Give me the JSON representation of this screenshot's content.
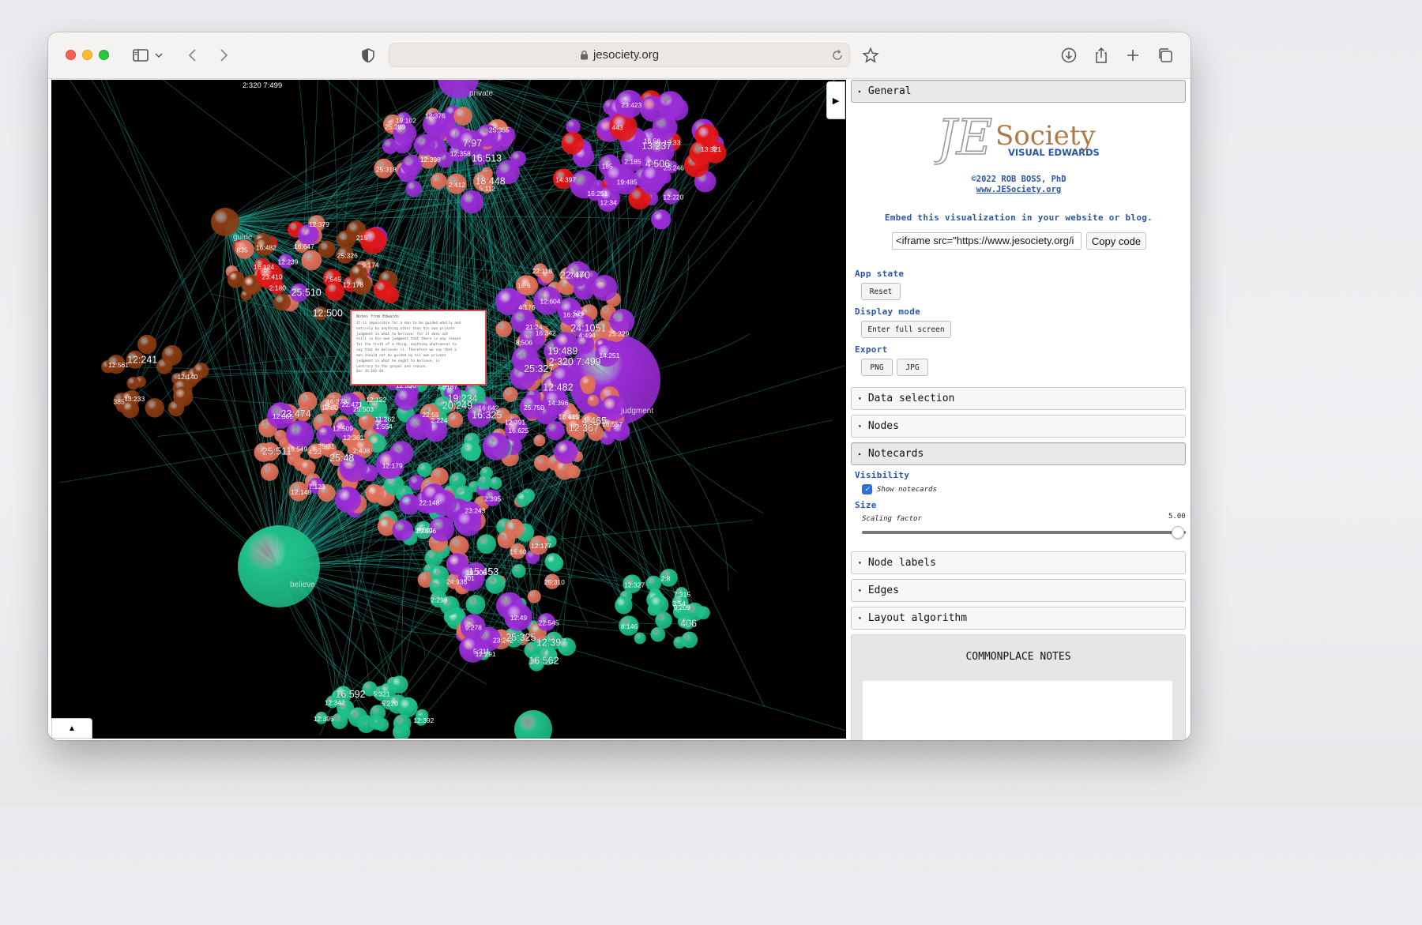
{
  "browser": {
    "url": "jesociety.org",
    "icons": [
      "sidebar-icon",
      "chevron-down-icon",
      "back-icon",
      "forward-icon",
      "shield-icon",
      "lock-icon",
      "reload-icon",
      "bookmark-star-icon",
      "download-icon",
      "share-icon",
      "new-tab-icon",
      "tabs-overview-icon"
    ]
  },
  "viz": {
    "collapse_glyph": "▶",
    "expand_glyph": "▲",
    "colors": {
      "background": "#000000",
      "edge": "#1fa595",
      "green": "#1fbf8a",
      "purple": "#9a2cd6",
      "red": "#e31616",
      "salmon": "#e0705a",
      "brown": "#8a3a12"
    },
    "hub_labels": [
      "private",
      "guide",
      "believe",
      "judgment"
    ],
    "node_labels": [
      "2:320 7:499",
      "1:554",
      "8:506",
      "9:209",
      "15:60",
      "16:592",
      "2:8",
      "5:648",
      "23:242",
      "22:148",
      "7:97",
      "8:601",
      "2:408",
      "12:509",
      "12:178",
      "12:367",
      "12:336",
      "12:561",
      "25:318",
      "185",
      "25:327",
      "526",
      "25:246",
      "16:647",
      "25:310",
      "22:470",
      "25:326",
      "7:545",
      "12:33",
      "14:397",
      "16:325",
      "12:604",
      "16:1",
      "22:118",
      "5:321",
      "24:1051",
      "16:549",
      "22:545",
      "16:642",
      "25:355",
      "19:489",
      "19:485",
      "11:262",
      "12:122",
      "2:180",
      "25:48",
      "3:54",
      "25:329",
      "2:224",
      "12:398",
      "4:506",
      "7:484",
      "12:140",
      "7:315",
      "5:220",
      "4:465",
      "16:251",
      "5:211",
      "19:80",
      "16:6",
      "13:237",
      "25:750",
      "12:179",
      "12:342",
      "12:376",
      "16:513",
      "16:557",
      "12:379",
      "12:358",
      "12:361",
      "25:325",
      "16:282",
      "12:365",
      "12:392",
      "16:342",
      "16:562",
      "12:391",
      "16:124",
      "16:273",
      "12:327",
      "18:448",
      "2:185",
      "9:278",
      "9:174",
      "25:289",
      "12:500",
      "4:22",
      "7:123",
      "4:494",
      "16:482",
      "23:474",
      "2:412",
      "16:56",
      "23:423",
      "12:395",
      "12:397",
      "4:176",
      "24:936",
      "2:395",
      "25:396",
      "15:453",
      "22:55",
      "16:625",
      "23:410",
      "12:187",
      "19:234",
      "12:239",
      "385",
      "12:499",
      "19:708",
      "25:511",
      "12:148",
      "22:471",
      "14:396",
      "5:112",
      "12:482",
      "12:291",
      "19:102",
      "12:220",
      "25:503",
      "25:510",
      "12:177",
      "12:34",
      "14:251",
      "12:49",
      "20:249",
      "25:31",
      "21:24",
      "23:243",
      "2:298",
      "12:241",
      "835",
      "8:146",
      "443",
      "301",
      "406",
      "215",
      "13:321",
      "13:233"
    ]
  },
  "notecard": {
    "title": "Notes from Edwards",
    "lines": [
      "It is impossible for a man to be guided wholly and",
      "entirely by anything other than his own private",
      "judgment in what to believe; for it does not",
      "still in his own judgment that there is any reason",
      "for the truth of a thing, anything whatsoever to",
      "say that he believes it. Therefore we say that a",
      "man should not be guided by his own private",
      "judgment in what he ought to believe, is",
      "contrary to the gospel and reason.",
      "Doc 16:182-84."
    ]
  },
  "panel": {
    "general": {
      "label": "General",
      "arrow": "▸"
    },
    "logo": {
      "mark": "JE",
      "word": "Society",
      "tagline": "VISUAL EDWARDS"
    },
    "credit": "©2022 ROB BOSS, PhD",
    "credit_link": "www.JESociety.org",
    "embed_caption": "Embed this visualization in your website or blog.",
    "embed_code": "<iframe src=\"https://www.jesociety.org/i",
    "copy_label": "Copy code",
    "app_state": {
      "label": "App state",
      "button": "Reset"
    },
    "display_mode": {
      "label": "Display mode",
      "button": "Enter full screen"
    },
    "export": {
      "label": "Export",
      "png": "PNG",
      "jpg": "JPG"
    },
    "sections": {
      "data_selection": {
        "label": "Data selection",
        "arrow": "▾"
      },
      "nodes": {
        "label": "Nodes",
        "arrow": "▾"
      },
      "notecards": {
        "label": "Notecards",
        "arrow": "▸"
      },
      "node_labels": {
        "label": "Node labels",
        "arrow": "▾"
      },
      "edges": {
        "label": "Edges",
        "arrow": "▾"
      },
      "layout": {
        "label": "Layout algorithm",
        "arrow": "▾"
      }
    },
    "visibility": {
      "label": "Visibility",
      "checkbox_label": "Show notecards",
      "checked": true
    },
    "size": {
      "label": "Size",
      "slider_label": "Scaling factor",
      "value": "5.00",
      "fraction": 1.0
    },
    "notes_title": "COMMONPLACE NOTES"
  }
}
